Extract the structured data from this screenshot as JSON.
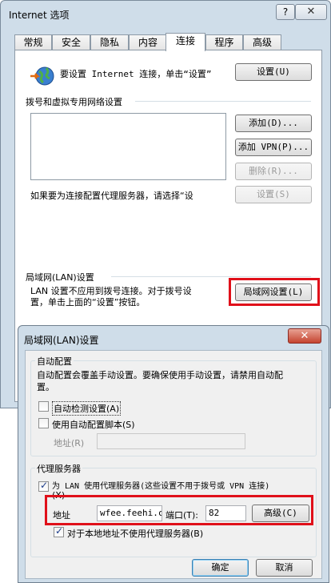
{
  "internet_options": {
    "title": "Internet 选项",
    "help_label": "?",
    "close_label": "✕",
    "tabs": [
      "常规",
      "安全",
      "隐私",
      "内容",
      "连接",
      "程序",
      "高级"
    ],
    "active_tab": "连接",
    "setup_text": "要设置 Internet 连接，单击“设置”",
    "setup_button": "设置(U)",
    "dialup_heading": "拨号和虚拟专用网络设置",
    "add_button": "添加(D)...",
    "add_vpn_button": "添加 VPN(P)...",
    "remove_button": "删除(R)...",
    "settings_button": "设置(S)",
    "proxy_hint": "如果要为连接配置代理服务器，请选择“设",
    "lan_heading": "局域网(LAN)设置",
    "lan_text_line1": "LAN 设置不应用到拨号连接。对于拨号设",
    "lan_text_line2": "置，单击上面的“设置”按钮。",
    "lan_button": "局域网设置(L)"
  },
  "lan_dialog": {
    "title": "局域网(LAN)设置",
    "close_label": "✕",
    "auto_config": {
      "heading": "自动配置",
      "desc_line1": "自动配置会覆盖手动设置。要确保使用手动设置，请禁用自动配",
      "desc_line2": "置。",
      "auto_detect_label": "自动检测设置(A)",
      "auto_detect_checked": false,
      "use_script_label": "使用自动配置脚本(S)",
      "use_script_checked": false,
      "address_label": "地址(R)",
      "address_value": ""
    },
    "proxy": {
      "heading": "代理服务器",
      "use_proxy_label_line1": "为 LAN 使用代理服务器(这些设置不用于拨号或 VPN 连接)",
      "use_proxy_label_line2": "(X)",
      "use_proxy_checked": true,
      "address_label": "地址",
      "address_value": "wfee.feehi.cc",
      "port_label": "端口(T):",
      "port_value": "82",
      "advanced_button": "高级(C)",
      "bypass_label": "对于本地地址不使用代理服务器(B)",
      "bypass_checked": true
    },
    "ok_button": "确定",
    "cancel_button": "取消"
  },
  "colors": {
    "highlight_box": "#e0101a",
    "window_frame": "#cfdde9"
  }
}
